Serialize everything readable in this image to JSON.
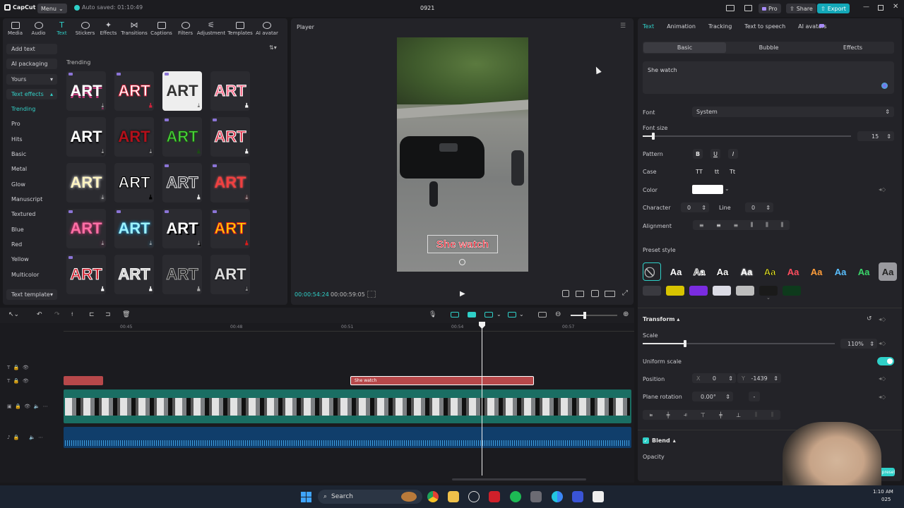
{
  "titlebar": {
    "logo": "CapCut",
    "menu": "Menu",
    "autosave": "Auto saved: 01:10:49",
    "project": "0921",
    "pro": "Pro",
    "share": "Share",
    "export": "Export"
  },
  "top_tabs": [
    "Media",
    "Audio",
    "Text",
    "Stickers",
    "Effects",
    "Transitions",
    "Captions",
    "Filters",
    "Adjustment",
    "Templates",
    "AI avatar"
  ],
  "sidebar": {
    "add_text": "Add text",
    "ai_packaging": "AI packaging",
    "yours": "Yours",
    "text_effects": "Text effects",
    "items": [
      "Trending",
      "Pro",
      "Hits",
      "Basic",
      "Metal",
      "Glow",
      "Manuscript",
      "Textured",
      "Blue",
      "Red",
      "Yellow",
      "Multicolor"
    ],
    "text_template": "Text template"
  },
  "library": {
    "section": "Trending",
    "tile_text": "ART"
  },
  "player": {
    "title": "Player",
    "caption": "She watch",
    "time_current": "00:00:54:24",
    "time_total": "00:00:59:05"
  },
  "inspector": {
    "tabs": [
      "Text",
      "Animation",
      "Tracking",
      "Text to speech",
      "AI avatars"
    ],
    "subtabs": [
      "Basic",
      "Bubble",
      "Effects"
    ],
    "text_value": "She watch",
    "font_label": "Font",
    "font_value": "System",
    "font_size_label": "Font size",
    "font_size_value": "15",
    "font_size_fraction": 0.05,
    "pattern_label": "Pattern",
    "pattern_buttons": [
      "B",
      "U",
      "I"
    ],
    "case_label": "Case",
    "case_buttons": [
      "TT",
      "tt",
      "Tt"
    ],
    "color_label": "Color",
    "color_value": "#ffffff",
    "character_label": "Character",
    "character_value": "0",
    "line_label": "Line",
    "line_value": "0",
    "alignment_label": "Alignment",
    "preset_label": "Preset style",
    "preset_text": "Aa",
    "transform_label": "Transform",
    "scale_label": "Scale",
    "scale_value": "110%",
    "scale_fraction": 0.22,
    "uniform_label": "Uniform scale",
    "position_label": "Position",
    "x_label": "X",
    "x_value": "0",
    "y_label": "Y",
    "y_value": "-1439",
    "rotation_label": "Plane rotation",
    "rotation_value": "0.00°",
    "rotation_extra": "-",
    "blend_label": "Blend",
    "opacity_label": "Opacity",
    "save_preset": "Save as preset"
  },
  "timeline": {
    "ruler": [
      "00:45",
      "00:48",
      "00:51",
      "00:54",
      "00:57"
    ],
    "text_clip": "She watch"
  },
  "taskbar": {
    "search": "Search",
    "time": "1:10 AM",
    "date": "025"
  },
  "colors": {
    "accent": "#2fd0c8",
    "export": "#13a8b8",
    "text_clip": "#b7484a",
    "video_track": "#1a6e63",
    "audio_track": "#103e6b"
  }
}
